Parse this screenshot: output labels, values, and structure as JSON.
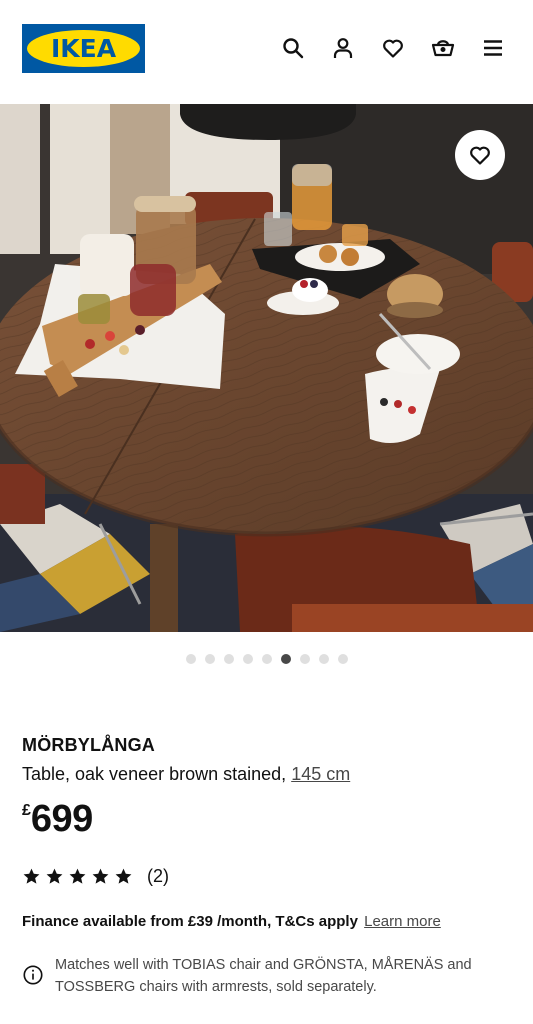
{
  "header": {
    "logo_text": "IKEA",
    "icons": [
      "search-icon",
      "profile-icon",
      "heart-icon",
      "basket-icon",
      "menu-icon"
    ]
  },
  "gallery": {
    "favourite_icon": "heart-icon",
    "dot_count": 9,
    "active_dot": 6
  },
  "product": {
    "name": "MÖRBYLÅNGA",
    "description": "Table, oak veneer brown stained,",
    "size_link": "145 cm",
    "currency": "£",
    "price": "699",
    "rating": 5,
    "review_count": "(2)",
    "finance_text": "Finance available from £39 /month, T&Cs apply",
    "learn_more": "Learn more",
    "matches_text": "Matches well with TOBIAS chair and GRÖNSTA, MÅRENÄS and TOSSBERG chairs with armrests, sold separately."
  },
  "colors": {
    "ikea_blue": "#0058a3",
    "ikea_yellow": "#ffdb00",
    "table_wood": "#6e4a33",
    "chair_rust": "#8a3b22"
  }
}
